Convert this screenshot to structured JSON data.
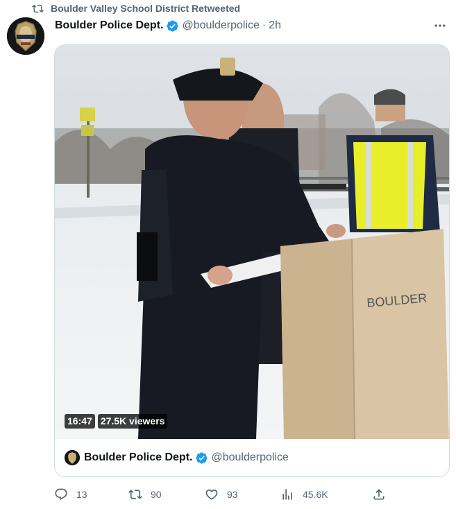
{
  "retweet": {
    "label": "Boulder Valley School District Retweeted"
  },
  "tweet": {
    "author_name": "Boulder Police Dept.",
    "handle": "@boulderpolice",
    "separator": "·",
    "time": "2h"
  },
  "media": {
    "duration": "16:47",
    "viewers": "27.5K viewers",
    "podium_text": "BOULDER"
  },
  "card": {
    "author_name": "Boulder Police Dept.",
    "handle": "@boulderpolice"
  },
  "actions": {
    "replies": "13",
    "retweets": "90",
    "likes": "93",
    "views": "45.6K"
  },
  "colors": {
    "verified": "#1d9bf0",
    "text_secondary": "#536471",
    "border": "#cfd9de"
  },
  "icons": [
    "retweet-icon",
    "verified-badge-icon",
    "more-icon",
    "reply-icon",
    "retweet-icon",
    "like-icon",
    "views-icon",
    "share-icon"
  ]
}
